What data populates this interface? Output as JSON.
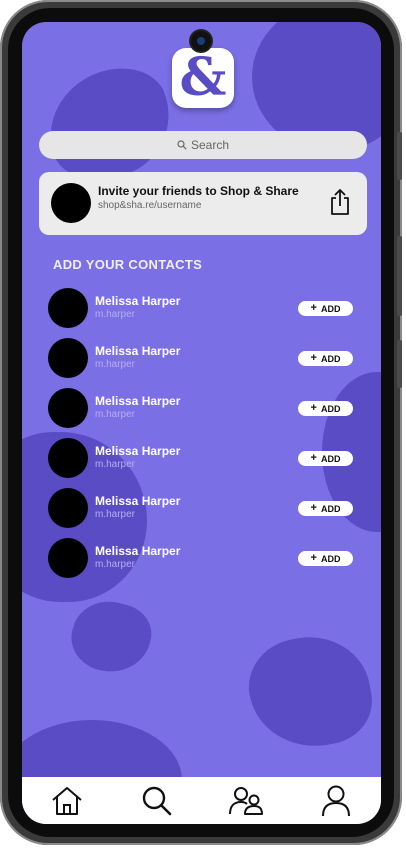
{
  "search": {
    "placeholder": "Search"
  },
  "invite": {
    "title": "Invite your friends to Shop & Share",
    "link": "shop&sha.re/username"
  },
  "section_title": "ADD YOUR CONTACTS",
  "contacts": [
    {
      "name": "Melissa Harper",
      "handle": "m.harper",
      "action": "ADD"
    },
    {
      "name": "Melissa Harper",
      "handle": "m.harper",
      "action": "ADD"
    },
    {
      "name": "Melissa Harper",
      "handle": "m.harper",
      "action": "ADD"
    },
    {
      "name": "Melissa Harper",
      "handle": "m.harper",
      "action": "ADD"
    },
    {
      "name": "Melissa Harper",
      "handle": "m.harper",
      "action": "ADD"
    },
    {
      "name": "Melissa Harper",
      "handle": "m.harper",
      "action": "ADD"
    }
  ],
  "nav": {
    "items": [
      {
        "icon": "home-icon"
      },
      {
        "icon": "search-icon"
      },
      {
        "icon": "friends-icon"
      },
      {
        "icon": "profile-icon"
      }
    ]
  },
  "logo": {
    "glyph": "&"
  },
  "colors": {
    "background": "#7b6fe6",
    "blob": "#5a4cc4",
    "card": "#ececec",
    "accent": "#5a4cc4"
  }
}
